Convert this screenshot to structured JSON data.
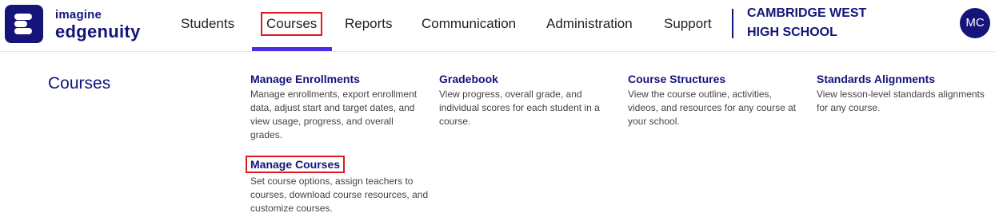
{
  "brand": {
    "line1": "imagine",
    "line2": "edgenuity",
    "color": "#14147a"
  },
  "nav": {
    "items": [
      "Students",
      "Courses",
      "Reports",
      "Communication",
      "Administration",
      "Support"
    ],
    "active": "Courses",
    "active_color": "#4f2de8",
    "highlight_color": "#e0191e"
  },
  "school": {
    "name": "CAMBRIDGE WEST HIGH SCHOOL"
  },
  "user": {
    "initials": "MC"
  },
  "panel": {
    "title": "Courses",
    "cards": [
      {
        "title": "Manage Enrollments",
        "description": "Manage enrollments, export enrollment data, adjust start and target dates, and view usage, progress, and overall grades."
      },
      {
        "title": "Gradebook",
        "description": "View progress, overall grade, and individual scores for each student in a course."
      },
      {
        "title": "Course Structures",
        "description": "View the course outline, activities, videos, and resources for any course at your school."
      },
      {
        "title": "Standards Alignments",
        "description": "View lesson-level standards alignments for any course."
      },
      {
        "title": "Manage Courses",
        "description": "Set course options, assign teachers to courses, download course resources, and customize courses."
      }
    ]
  }
}
